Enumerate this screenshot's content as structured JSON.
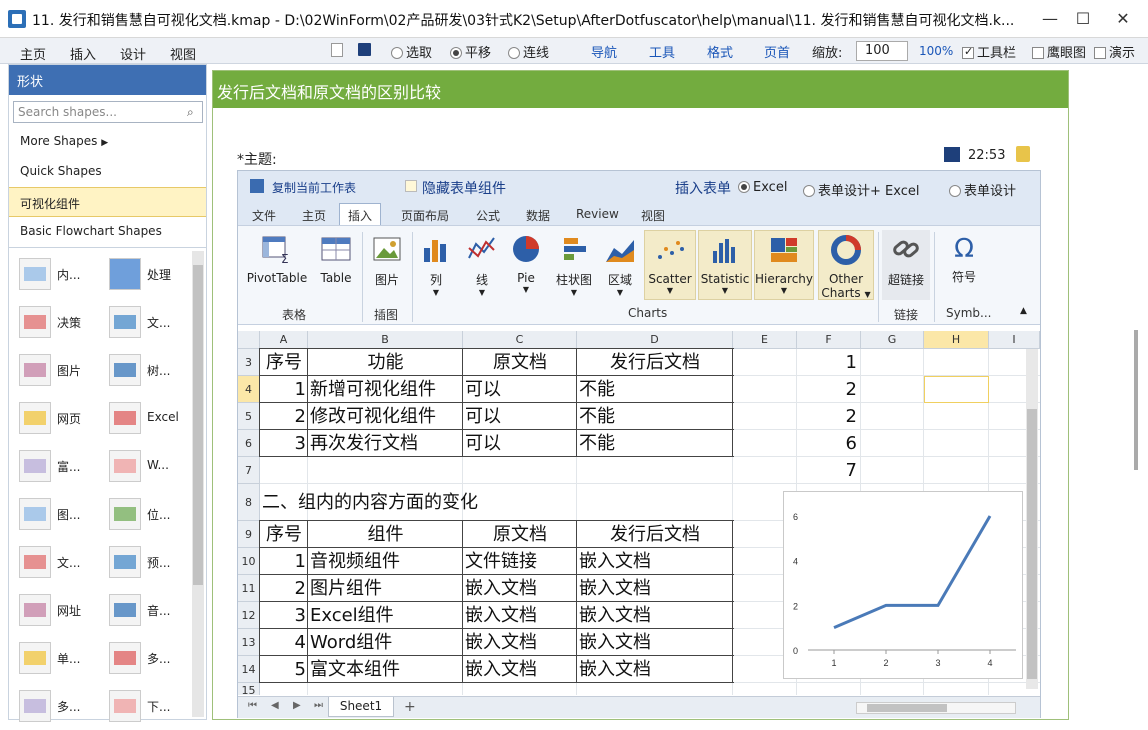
{
  "window": {
    "title": "11. 发行和销售慧自可视化文档.kmap -  D:\\02WinForm\\02产品研发\\03针式K2\\Setup\\AfterDotfuscator\\help\\manual\\11. 发行和销售慧自可视化文档.k...",
    "min": "—",
    "max": "☐",
    "close": "✕"
  },
  "menu": [
    "主页",
    "插入",
    "设计",
    "视图"
  ],
  "toolbar": {
    "mode_select": "选取",
    "mode_pan": "平移",
    "mode_connect": "连线",
    "nav": "导航",
    "tools": "工具",
    "format": "格式",
    "home": "页首",
    "zoom_label": "缩放:",
    "zoom_value": "100",
    "zoom_pct": "100%",
    "toolbar_chk": "工具栏",
    "eagle_chk": "鹰眼图",
    "present_chk": "演示"
  },
  "left": {
    "title": "形状",
    "search_placeholder": "Search shapes...",
    "cats": [
      "More Shapes",
      "Quick Shapes",
      "可视化组件",
      "Basic Flowchart Shapes"
    ],
    "shapes": [
      [
        "内...",
        "处理"
      ],
      [
        "决策",
        "文..."
      ],
      [
        "图片",
        "树..."
      ],
      [
        "网页",
        "Excel"
      ],
      [
        "富...",
        "W..."
      ],
      [
        "图...",
        "位..."
      ],
      [
        "文...",
        "预..."
      ],
      [
        "网址",
        "音..."
      ],
      [
        "单...",
        "多..."
      ],
      [
        "多...",
        "下..."
      ]
    ]
  },
  "main": {
    "heading": "发行后文档和原文档的区别比较",
    "topic": "*主题:",
    "time": "22:53"
  },
  "excel": {
    "copy_ws": "复制当前工作表",
    "hide_form": "隐藏表单组件",
    "insert_table": "插入表单",
    "opt_excel": "Excel",
    "opt_design_excel": "表单设计+ Excel",
    "opt_design": "表单设计",
    "tabs": [
      "文件",
      "主页",
      "插入",
      "页面布局",
      "公式",
      "数据",
      "Review",
      "视图"
    ],
    "ribbon": {
      "pivot": "PivotTable",
      "table": "Table",
      "pic": "图片",
      "col": "列",
      "line": "线",
      "pie": "Pie",
      "bar": "柱状图",
      "area": "区域",
      "scatter": "Scatter",
      "statistic": "Statistic",
      "hierarchy": "Hierarchy",
      "other1": "Other",
      "other2": "Charts",
      "link": "超链接",
      "sym": "符号",
      "g_table": "表格",
      "g_pic": "插图",
      "g_charts": "Charts",
      "g_link": "链接",
      "g_sym": "Symb..."
    },
    "cols": [
      "A",
      "B",
      "C",
      "D",
      "E",
      "F",
      "G",
      "H",
      "I"
    ],
    "rows": [
      "3",
      "4",
      "5",
      "6",
      "7",
      "8",
      "9",
      "10",
      "11",
      "12",
      "13",
      "14",
      "15"
    ],
    "t1_header": [
      "序号",
      "功能",
      "原文档",
      "发行后文档"
    ],
    "t1_rows": [
      [
        "1",
        "新增可视化组件",
        "可以",
        "不能"
      ],
      [
        "2",
        "修改可视化组件",
        "可以",
        "不能"
      ],
      [
        "3",
        "再次发行文档",
        "可以",
        "不能"
      ]
    ],
    "section2": "二、组内的内容方面的变化",
    "t2_header": [
      "序号",
      "组件",
      "原文档",
      "发行后文档"
    ],
    "t2_rows": [
      [
        "1",
        "音视频组件",
        "文件链接",
        "嵌入文档"
      ],
      [
        "2",
        "图片组件",
        "嵌入文档",
        "嵌入文档"
      ],
      [
        "3",
        "Excel组件",
        "嵌入文档",
        "嵌入文档"
      ],
      [
        "4",
        "Word组件",
        "嵌入文档",
        "嵌入文档"
      ],
      [
        "5",
        "富文本组件",
        "嵌入文档",
        "嵌入文档"
      ]
    ],
    "f_values": [
      "1",
      "2",
      "2",
      "6",
      "7"
    ],
    "sheet": "Sheet1",
    "add_sheet": "+"
  },
  "chart_data": {
    "type": "line",
    "x": [
      1,
      2,
      3,
      4
    ],
    "values": [
      1,
      2,
      2,
      6
    ],
    "xlim": [
      0.5,
      4.5
    ],
    "ylim": [
      0,
      6
    ],
    "yticks": [
      "0",
      "2",
      "4",
      "6"
    ],
    "xticks": [
      "1",
      "2",
      "3",
      "4"
    ],
    "color": "#4a7ab8"
  }
}
